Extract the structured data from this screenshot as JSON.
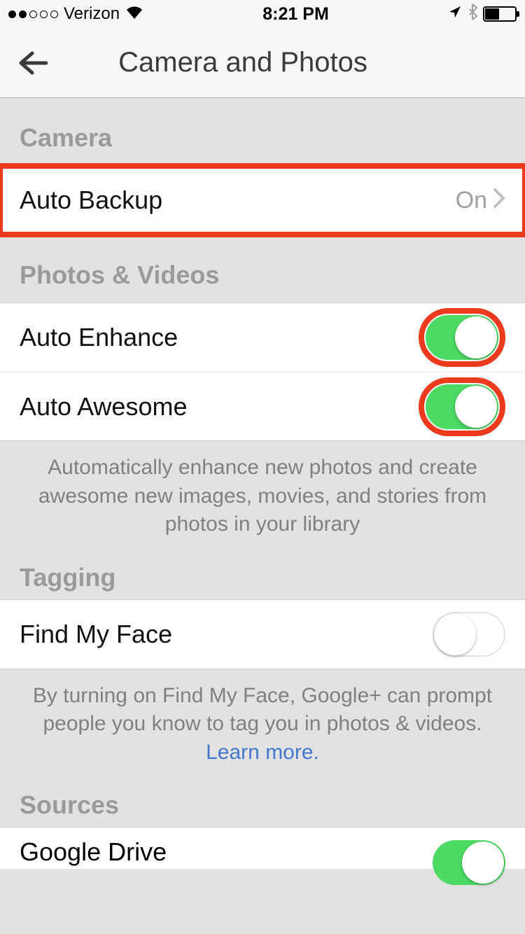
{
  "statusbar": {
    "signal_dots_filled": 2,
    "signal_dots_total": 5,
    "carrier": "Verizon",
    "time": "8:21 PM"
  },
  "header": {
    "title": "Camera and Photos"
  },
  "sections": {
    "camera": {
      "header": "Camera",
      "auto_backup": {
        "label": "Auto Backup",
        "value": "On"
      }
    },
    "photos_videos": {
      "header": "Photos & Videos",
      "auto_enhance": {
        "label": "Auto Enhance",
        "on": true
      },
      "auto_awesome": {
        "label": "Auto Awesome",
        "on": true
      },
      "description": "Automatically enhance new photos and create awesome new images, movies, and stories from photos in your library"
    },
    "tagging": {
      "header": "Tagging",
      "find_my_face": {
        "label": "Find My Face",
        "on": false
      },
      "description_prefix": "By turning on Find My Face, Google+ can prompt people you know to tag you in photos & videos. ",
      "learn_more": "Learn more."
    },
    "sources": {
      "header": "Sources",
      "google_drive": {
        "label": "Google Drive",
        "on": true
      }
    }
  }
}
